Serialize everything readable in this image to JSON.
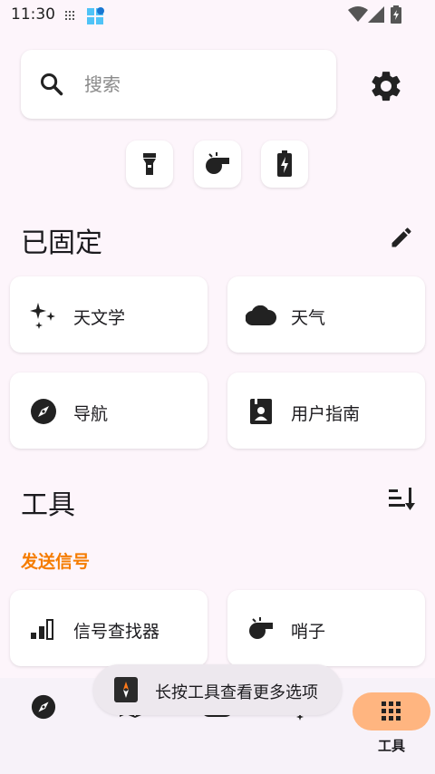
{
  "status_bar": {
    "time": "11:30"
  },
  "search": {
    "placeholder": "搜索"
  },
  "quick_actions": [
    {
      "icon": "flashlight-icon"
    },
    {
      "icon": "whistle-icon"
    },
    {
      "icon": "battery-charging-icon"
    }
  ],
  "pinned": {
    "title": "已固定",
    "tiles": [
      {
        "label": "天文学",
        "icon": "sparkles-icon"
      },
      {
        "label": "天气",
        "icon": "cloud-icon"
      },
      {
        "label": "导航",
        "icon": "compass-icon"
      },
      {
        "label": "用户指南",
        "icon": "user-guide-icon"
      }
    ]
  },
  "tools": {
    "title": "工具",
    "category": "发送信号",
    "tiles": [
      {
        "label": "信号查找器",
        "icon": "signal-bars-icon"
      },
      {
        "label": "哨子",
        "icon": "whistle-icon"
      }
    ]
  },
  "toast": {
    "text": "长按工具查看更多选项"
  },
  "bottom_nav": {
    "items": [
      {
        "icon": "compass-icon"
      },
      {
        "icon": "map-icon"
      },
      {
        "icon": "cloud-icon"
      },
      {
        "icon": "sparkles-icon"
      },
      {
        "icon": "grid-icon",
        "label": "工具",
        "active": true
      }
    ]
  },
  "colors": {
    "accent": "#f57c00",
    "nav_pill": "#ffb580",
    "background": "#fdf5fb"
  }
}
